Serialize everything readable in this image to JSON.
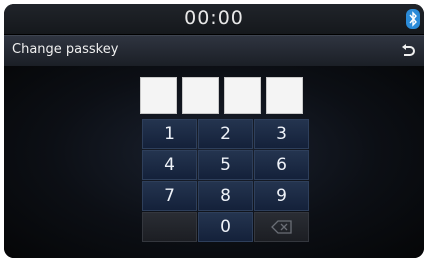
{
  "status_bar": {
    "time": "00:00",
    "bluetooth_icon": "bluetooth-icon"
  },
  "title_bar": {
    "title": "Change passkey",
    "back_icon": "back-arrow-icon"
  },
  "passkey": {
    "digits": [
      "",
      "",
      "",
      ""
    ]
  },
  "keypad": {
    "k1": "1",
    "k2": "2",
    "k3": "3",
    "k4": "4",
    "k5": "5",
    "k6": "6",
    "k7": "7",
    "k8": "8",
    "k9": "9",
    "k0": "0",
    "delete_icon": "backspace-icon"
  },
  "colors": {
    "key_blue": "#1c2b46",
    "bluetooth_blue": "#2b8bd8",
    "background": "#000000"
  }
}
